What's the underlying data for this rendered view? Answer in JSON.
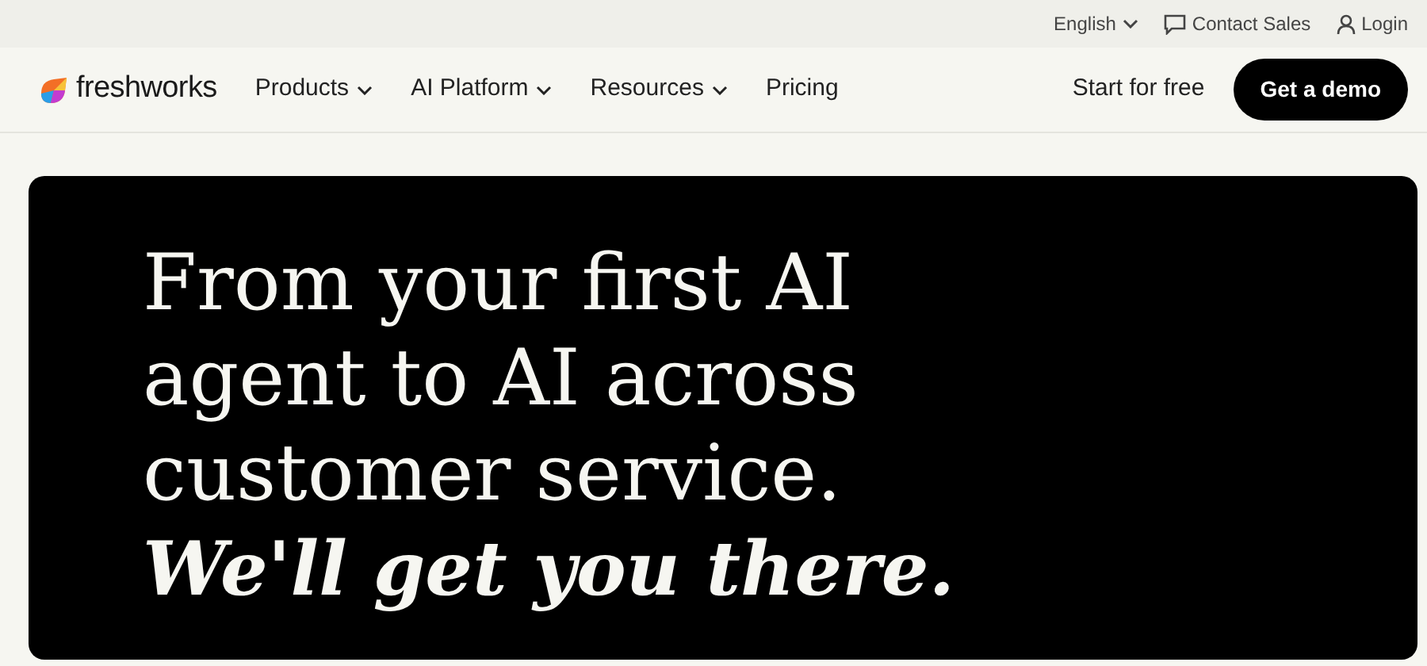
{
  "utility_bar": [
    {
      "kind": "language",
      "label": "English"
    },
    {
      "kind": "contact",
      "label": "Contact Sales"
    },
    {
      "kind": "login",
      "label": "Login"
    }
  ],
  "navbar": {
    "logo": "freshworks",
    "items": [
      {
        "label": "Products",
        "has_menu": true
      },
      {
        "label": "AI Platform",
        "has_menu": true
      },
      {
        "label": "Resources",
        "has_menu": true
      },
      {
        "label": "Pricing",
        "has_menu": false
      }
    ],
    "start_link": "Start for free",
    "demo_button": "Get a demo"
  },
  "hero": {
    "headline": "From your first AI agent to AI across customer service.",
    "tagline": "We'll get you there."
  }
}
